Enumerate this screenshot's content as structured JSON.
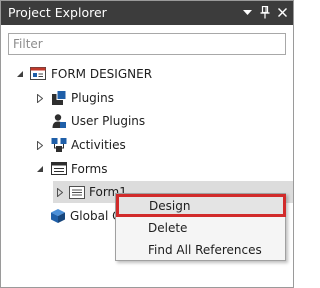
{
  "panel": {
    "title": "Project Explorer",
    "filter_placeholder": "Filter"
  },
  "tree": {
    "root_label": "FORM DESIGNER",
    "plugins_label": "Plugins",
    "user_plugins_label": "User Plugins",
    "activities_label": "Activities",
    "forms_label": "Forms",
    "form1_label": "Form1",
    "global_label": "Global C"
  },
  "context_menu": {
    "design_label": "Design",
    "delete_label": "Delete",
    "find_refs_label": "Find All References"
  },
  "colors": {
    "titlebar": "#3c3c3c",
    "highlight_border": "#d12b2b",
    "icon_blue": "#1f5fa8"
  }
}
